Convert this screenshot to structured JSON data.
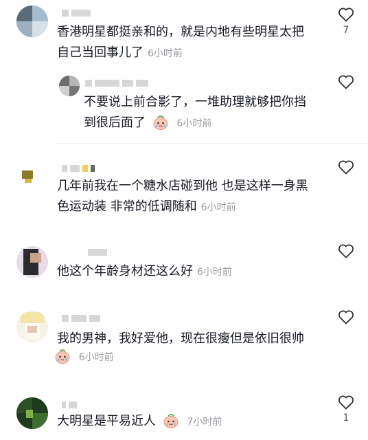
{
  "comments": [
    {
      "text_lines": [
        "香港明星都挺亲和的，就是内地有些明星太把",
        "自己当回事儿了"
      ],
      "time": "6小时前",
      "likes": "7"
    },
    {
      "text_lines": [
        "不要说上前合影了，一堆助理就够把你挡",
        "到很后面了"
      ],
      "time": "6小时前",
      "likes": "",
      "reply": true,
      "emoji": "crying-face-sticker"
    },
    {
      "text_lines": [
        "几年前我在一个糖水店碰到他 也是这样一身黑",
        "色运动装 非常的低调随和"
      ],
      "time": "6小时前",
      "likes": ""
    },
    {
      "text_lines": [
        "他这个年龄身材还这么好"
      ],
      "time": "6小时前",
      "likes": ""
    },
    {
      "text_lines": [
        "我的男神，我好爱他，现在很瘦但是依旧很帅"
      ],
      "time": "6小时前",
      "likes": "",
      "emoji": "crying-face-sticker"
    },
    {
      "text_lines": [
        "大明星是平易近人"
      ],
      "time": "7小时前",
      "likes": "1",
      "emoji": "crying-face-sticker"
    }
  ],
  "colors": {
    "text": "#161823",
    "meta": "#9a9aa0",
    "heart": "#2f2f33"
  },
  "icons": {
    "like": "heart-outline-icon"
  }
}
